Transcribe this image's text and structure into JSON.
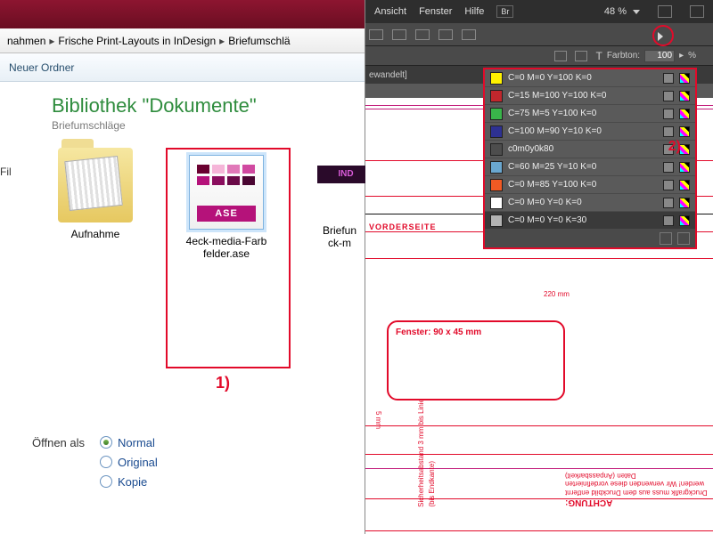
{
  "explorer": {
    "breadcrumb": [
      "nahmen",
      "Frische Print-Layouts in InDesign",
      "Briefumschlä"
    ],
    "toolbar_new_folder": "Neuer Ordner",
    "library_title": "Bibliothek \"Dokumente\"",
    "library_sub": "Briefumschläge",
    "sidebar_item": "Fil",
    "items": [
      {
        "label": "Aufnahme"
      },
      {
        "label1": "4eck-media-Farb",
        "label2": "felder.ase",
        "ase_text": "ASE"
      },
      {
        "label1": "Briefun",
        "label2": "ck-m",
        "band": "IND"
      }
    ],
    "annotation1": "1)",
    "open_as_label": "Öffnen als",
    "open_as_options": [
      "Normal",
      "Original",
      "Kopie"
    ],
    "open_as_selected": 0
  },
  "indesign": {
    "menu": [
      "Ansicht",
      "Fenster",
      "Hilfe"
    ],
    "br": "Br",
    "zoom": "48 %",
    "farbton_label": "Farbton:",
    "farbton_value": "100",
    "farbton_unit": "%",
    "tab_label": "ewandelt]",
    "annotation2": "2)",
    "swatches": [
      {
        "name": "C=0 M=0 Y=100 K=0",
        "color": "#fff200"
      },
      {
        "name": "C=15 M=100 Y=100 K=0",
        "color": "#c1272d"
      },
      {
        "name": "C=75 M=5 Y=100 K=0",
        "color": "#39b54a"
      },
      {
        "name": "C=100 M=90 Y=10 K=0",
        "color": "#2e3192"
      },
      {
        "name": "c0m0y0k80",
        "color": "#4d4d4d"
      },
      {
        "name": "C=60 M=25 Y=10 K=0",
        "color": "#6aa7cf"
      },
      {
        "name": "C=0 M=85 Y=100 K=0",
        "color": "#f15a24"
      },
      {
        "name": "C=0 M=0 Y=0 K=0",
        "color": "#ffffff"
      },
      {
        "name": "C=0 M=0 Y=0 K=30",
        "color": "#b3b3b3",
        "selected": true
      }
    ],
    "canvas": {
      "front_label": "VORDERSEITE",
      "fenster_caption": "Fenster: 90 x 45 mm",
      "dim_top": "220 mm",
      "dim_side": "5 mm",
      "warning_title": "ACHTUNG:",
      "warning_body": "Druckgrafik muss aus dem Druckbild entfernt werden! Wir verwenden diese vordefinierten Daten (Anpassbarkeit)",
      "vlabel1": "Sicherheitsabstand 3 mm bis Linie",
      "vlabel2": "(bis Endkante)"
    }
  },
  "ase_swatches": [
    "#6a0030",
    "#f5b5d8",
    "#e078b8",
    "#d048a0",
    "#b5127a",
    "#8a0e5e",
    "#6a0a48",
    "#4a0632"
  ]
}
